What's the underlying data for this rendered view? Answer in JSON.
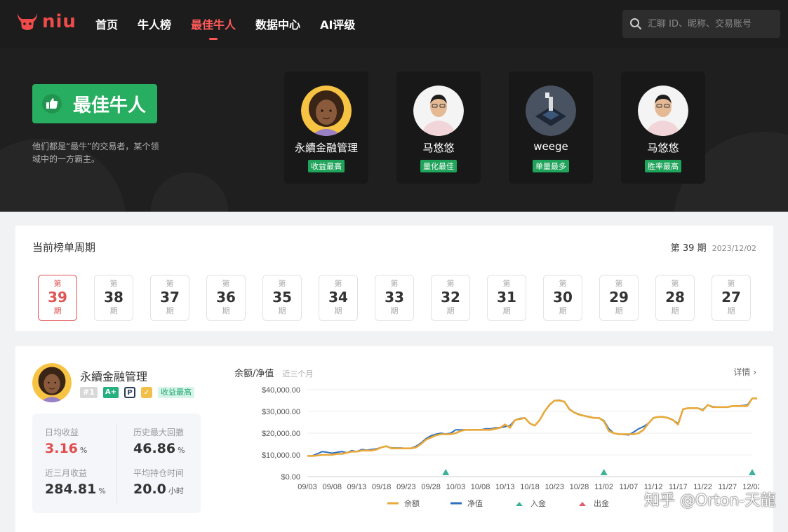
{
  "header": {
    "logo_text": "niu",
    "nav": [
      {
        "label": "首页",
        "active": false
      },
      {
        "label": "牛人榜",
        "active": false
      },
      {
        "label": "最佳牛人",
        "active": true
      },
      {
        "label": "数据中心",
        "active": false
      },
      {
        "label": "AI评级",
        "active": false
      }
    ],
    "search_placeholder": "汇聊 ID、昵称、交易账号"
  },
  "hero": {
    "badge": "最佳牛人",
    "description": "他们都是“最牛”的交易者，某个领域中的一方霸主。",
    "cards": [
      {
        "name": "永續金融管理",
        "tag": "收益最高",
        "avatar": "cartoon-woman"
      },
      {
        "name": "马悠悠",
        "tag": "量化最佳",
        "avatar": "man-photo"
      },
      {
        "name": "weege",
        "tag": "单量最多",
        "avatar": "chip-photo"
      },
      {
        "name": "马悠悠",
        "tag": "胜率最高",
        "avatar": "man-photo"
      }
    ]
  },
  "period_panel": {
    "title": "当前榜单周期",
    "current": "第 39 期",
    "current_date": "2023/12/02",
    "prefix": "第",
    "suffix": "期",
    "periods": [
      "39",
      "38",
      "37",
      "36",
      "35",
      "34",
      "33",
      "32",
      "31",
      "30",
      "29",
      "28",
      "27"
    ],
    "active_index": 0
  },
  "detail": {
    "name": "永續金融管理",
    "rank": "#1",
    "grade": "A+",
    "tag": "收益最高",
    "stats": [
      {
        "label": "日均收益",
        "value": "3.16",
        "unit": "%",
        "highlight": true
      },
      {
        "label": "历史最大回撤",
        "value": "46.86",
        "unit": "%",
        "highlight": false
      },
      {
        "label": "近三月收益",
        "value": "284.81",
        "unit": "%",
        "highlight": false
      },
      {
        "label": "平均持仓时间",
        "value": "20.0",
        "unit": "小时",
        "highlight": false
      }
    ],
    "chart_title": "余额/净值",
    "chart_subtitle": "近三个月",
    "detail_link": "详情 ›"
  },
  "chart_data": {
    "type": "line",
    "x": [
      "09/03",
      "09/04",
      "09/05",
      "09/06",
      "09/07",
      "09/08",
      "09/09",
      "09/10",
      "09/11",
      "09/12",
      "09/13",
      "09/14",
      "09/15",
      "09/16",
      "09/17",
      "09/18",
      "09/19",
      "09/20",
      "09/21",
      "09/22",
      "09/23",
      "09/24",
      "09/25",
      "09/26",
      "09/27",
      "09/28",
      "09/29",
      "09/30",
      "10/01",
      "10/02",
      "10/03",
      "10/04",
      "10/05",
      "10/06",
      "10/07",
      "10/08",
      "10/09",
      "10/10",
      "10/11",
      "10/12",
      "10/13",
      "10/14",
      "10/15",
      "10/16",
      "10/17",
      "10/18",
      "10/19",
      "10/20",
      "10/21",
      "10/22",
      "10/23",
      "10/24",
      "10/25",
      "10/26",
      "10/27",
      "10/28",
      "10/29",
      "10/30",
      "10/31",
      "11/01",
      "11/02",
      "11/03",
      "11/04",
      "11/05",
      "11/06",
      "11/07",
      "11/08",
      "11/09",
      "11/10",
      "11/11",
      "11/12",
      "11/13",
      "11/14",
      "11/15",
      "11/16",
      "11/17",
      "11/18",
      "11/19",
      "11/20",
      "11/21",
      "11/22",
      "11/23",
      "11/24",
      "11/25",
      "11/26",
      "11/27",
      "11/28",
      "11/29",
      "11/30",
      "12/01",
      "12/02"
    ],
    "x_ticks": [
      "09/03",
      "09/08",
      "09/13",
      "09/18",
      "09/23",
      "09/28",
      "10/03",
      "10/08",
      "10/13",
      "10/18",
      "10/23",
      "10/28",
      "11/02",
      "11/07",
      "11/12",
      "11/17",
      "11/22",
      "11/27",
      "12/02"
    ],
    "series": [
      {
        "name": "余额",
        "color": "#e8a93a",
        "values": [
          9500,
          9500,
          9700,
          10000,
          10000,
          10000,
          10500,
          10500,
          11000,
          11500,
          11500,
          12000,
          12000,
          12000,
          12500,
          13500,
          14000,
          13000,
          13000,
          13000,
          13000,
          13000,
          13500,
          15000,
          17000,
          18000,
          19000,
          19500,
          19500,
          19500,
          20000,
          21000,
          21500,
          21500,
          21500,
          21500,
          21500,
          21500,
          22000,
          22500,
          24000,
          22500,
          26000,
          26500,
          27000,
          24500,
          23500,
          26000,
          30000,
          33000,
          35000,
          35000,
          34500,
          31000,
          29500,
          28500,
          28000,
          27500,
          27000,
          27000,
          25500,
          21000,
          20000,
          19500,
          19500,
          19500,
          19500,
          20000,
          21500,
          24500,
          27000,
          27500,
          27500,
          27000,
          26000,
          24000,
          31000,
          31500,
          31500,
          31500,
          30500,
          33000,
          32000,
          32000,
          32000,
          32000,
          32500,
          32500,
          32500,
          32500,
          36000,
          36000
        ]
      },
      {
        "name": "净值",
        "color": "#2f6fbd",
        "values": [
          9500,
          9600,
          10500,
          11500,
          11200,
          10800,
          11200,
          11500,
          11000,
          12000,
          11500,
          12500,
          12200,
          12500,
          12800,
          13500,
          14000,
          13200,
          13200,
          13200,
          13000,
          13100,
          14000,
          15500,
          17500,
          18800,
          19500,
          20000,
          19600,
          20000,
          21500,
          21500,
          21500,
          21500,
          21500,
          21500,
          22000,
          22000,
          22500,
          22500,
          23000,
          23500,
          26000,
          26800,
          27000,
          24500,
          23500,
          26000,
          30000,
          33200,
          35000,
          35200,
          34500,
          31200,
          29500,
          28700,
          28000,
          27600,
          27000,
          27000,
          25800,
          22000,
          20000,
          19600,
          19400,
          19200,
          20500,
          22000,
          23000,
          24500,
          27000,
          27500,
          27500,
          27100,
          26000,
          24500,
          31000,
          31500,
          31500,
          31500,
          30800,
          33000,
          32200,
          32100,
          32000,
          32000,
          32500,
          32500,
          32700,
          33000,
          36000,
          36000
        ]
      },
      {
        "name": "入金",
        "color": "#3cb29a",
        "markers": [
          "10/01",
          "11/02",
          "12/02"
        ]
      },
      {
        "name": "出金",
        "color": "#e35b6b",
        "markers": []
      }
    ],
    "y_ticks": [
      "$0.00",
      "$10,000.00",
      "$20,000.00",
      "$30,000.00",
      "$40,000.00"
    ],
    "ylim": [
      0,
      40000
    ],
    "legend": [
      "余额",
      "净值",
      "入金",
      "出金"
    ],
    "legend_position": "bottom"
  },
  "watermark": "知乎 @Orton-天龍"
}
